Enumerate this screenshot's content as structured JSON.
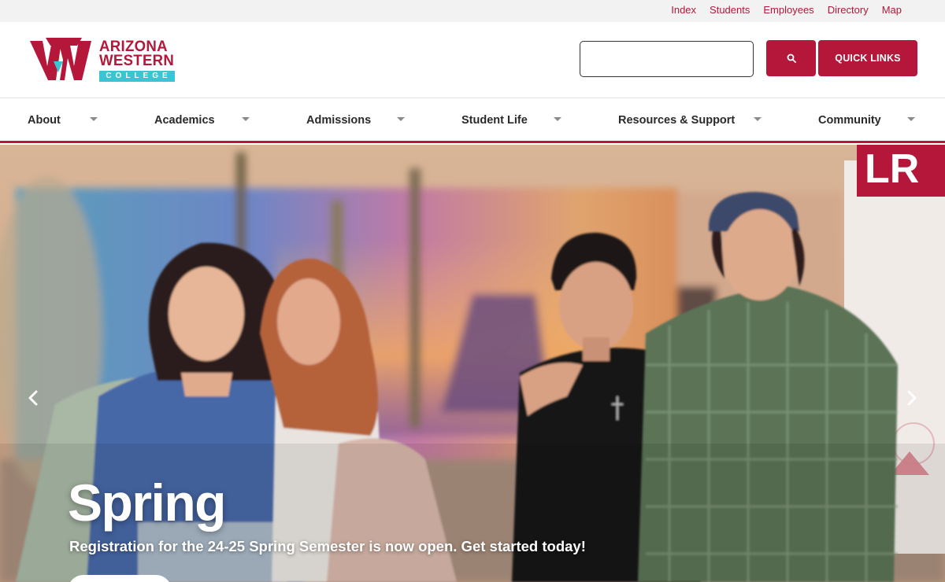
{
  "utility": {
    "links": [
      "Index",
      "Students",
      "Employees",
      "Directory",
      "Map"
    ]
  },
  "header": {
    "logo": {
      "line1": "ARIZONA",
      "line2": "WESTERN",
      "line3": "COLLEGE"
    },
    "search": {
      "value": "",
      "icon": "search-icon"
    },
    "quick_links_label": "QUICK LINKS"
  },
  "nav": {
    "items": [
      {
        "label": "About"
      },
      {
        "label": "Academics"
      },
      {
        "label": "Admissions"
      },
      {
        "label": "Student Life"
      },
      {
        "label": "Resources & Support"
      },
      {
        "label": "Community"
      }
    ]
  },
  "hero": {
    "title": "Spring",
    "subtitle": "Registration for the 24-25 Spring Semester is now open. Get started today!",
    "cta_label": "",
    "sign_text": "LR"
  },
  "colors": {
    "brand_red": "#b5173a",
    "brand_teal": "#3cc4d4"
  }
}
